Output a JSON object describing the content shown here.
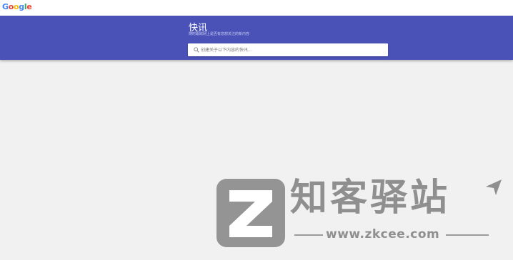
{
  "header": {
    "logo_letters": [
      "G",
      "o",
      "o",
      "g",
      "l",
      "e"
    ]
  },
  "banner": {
    "title": "快讯",
    "subtitle": "随时跟踪网上是否有您想关注的新内容"
  },
  "search": {
    "placeholder": "创建关于以下内容的快讯..."
  },
  "watermark": {
    "title": "知客驿站",
    "url": "www.zkcee.com"
  },
  "colors": {
    "banner": "#4a52b8",
    "page_background": "#f1f1f1",
    "watermark": "#8f8f8f"
  }
}
